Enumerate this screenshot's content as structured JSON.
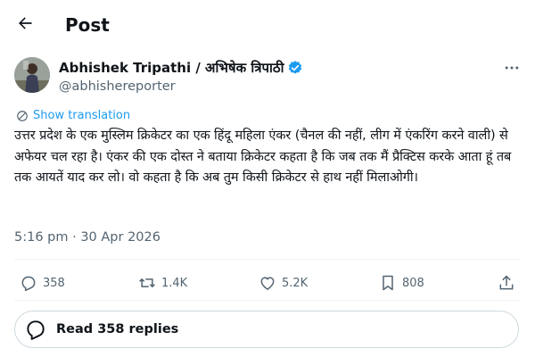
{
  "header": {
    "title": "Post"
  },
  "author": {
    "display_name": "Abhishek Tripathi / अभिषेक त्रिपाठी",
    "handle": "@abhishereporter"
  },
  "translate_label": "Show translation",
  "tweet_text": "उत्तर प्रदेश के एक मुस्लिम क्रिकेटर का एक हिंदू महिला एंकर (चैनल की नहीं, लीग में एंकरिंग करने वाली) से अफेयर चल रहा है। एंकर की एक दोस्त ने बताया क्रिकेटर कहता है कि जब तक मैं प्रैक्टिस करके आता हूं तब तक आयतें याद कर लो। वो कहता है कि अब तुम किसी क्रिकेटर से हाथ नहीं मिलाओगी।",
  "timestamp": "5:16 pm · 30 Apr 2026",
  "actions": {
    "replies": "358",
    "reposts": "1.4K",
    "likes": "5.2K",
    "bookmarks": "808"
  },
  "read_replies_label": "Read 358 replies",
  "colors": {
    "accent": "#1d9bf0",
    "muted": "#536471",
    "text": "#0f1419"
  },
  "icons": [
    "back-arrow-icon",
    "verified-badge-icon",
    "more-icon",
    "translate-icon",
    "reply-icon",
    "repost-icon",
    "like-icon",
    "bookmark-icon",
    "share-icon",
    "speech-bubble-icon"
  ]
}
